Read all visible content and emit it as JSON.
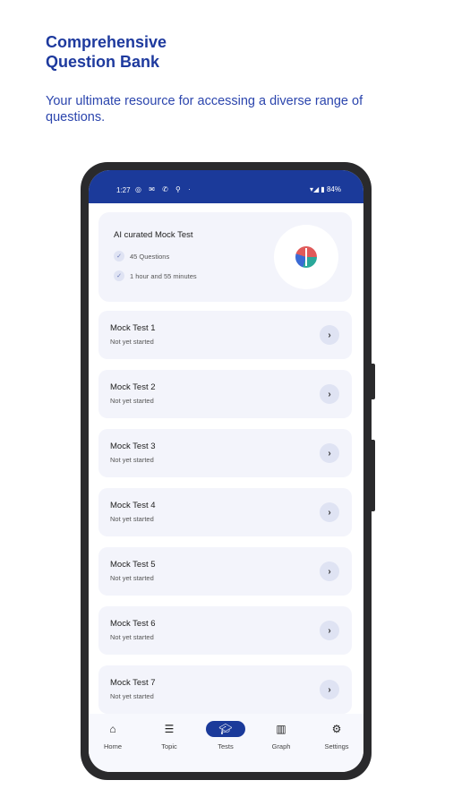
{
  "headline": [
    "Comprehensive",
    "Question Bank"
  ],
  "subhead": "Your ultimate resource for accessing a diverse range of questions.",
  "status_bar": {
    "time": "1:27",
    "battery": "84%"
  },
  "ai_card": {
    "title": "AI curated Mock Test",
    "questions": "45 Questions",
    "duration": "1 hour and 55 minutes",
    "icon": "brain-icon"
  },
  "tests": [
    {
      "name": "Mock Test 1",
      "status": "Not yet started"
    },
    {
      "name": "Mock Test 2",
      "status": "Not yet started"
    },
    {
      "name": "Mock Test 3",
      "status": "Not yet started"
    },
    {
      "name": "Mock Test 4",
      "status": "Not yet started"
    },
    {
      "name": "Mock Test 5",
      "status": "Not yet started"
    },
    {
      "name": "Mock Test 6",
      "status": "Not yet started"
    },
    {
      "name": "Mock Test 7",
      "status": "Not yet started"
    }
  ],
  "nav": [
    {
      "label": "Home",
      "icon": "home-icon"
    },
    {
      "label": "Topic",
      "icon": "topic-icon"
    },
    {
      "label": "Tests",
      "icon": "tests-icon",
      "active": true
    },
    {
      "label": "Graph",
      "icon": "graph-icon"
    },
    {
      "label": "Settings",
      "icon": "settings-icon"
    }
  ],
  "colors": {
    "brand": "#1b3a9a",
    "headline": "#1e3a9e",
    "card_bg": "#f3f4fb"
  }
}
